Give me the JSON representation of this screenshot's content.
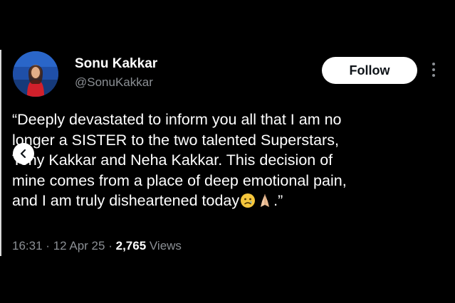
{
  "author": {
    "display_name": "Sonu Kakkar",
    "handle": "@SonuKakkar"
  },
  "follow_label": "Follow",
  "tweet": {
    "lines": [
      "“Deeply devastated to inform you all that I am no",
      "longer a SISTER to the two talented Superstars,",
      "Tony Kakkar and Neha Kakkar. This decision of",
      "mine comes from a place of deep emotional pain,",
      "and I am truly disheartened today"
    ],
    "closing": ".”",
    "emojis": [
      "sad-face-emoji",
      "folded-hands-emoji"
    ]
  },
  "meta": {
    "time": "16:31",
    "date": "12 Apr 25",
    "views_count": "2,765",
    "views_label": "Views",
    "separator": "·"
  },
  "icons": {
    "more": "vertical-dots-icon",
    "carousel": "chevron-left-icon"
  },
  "colors": {
    "background": "#000000",
    "text": "#ffffff",
    "secondary_text": "#8b8f94",
    "follow_bg": "#ffffff",
    "follow_text": "#0f1419"
  }
}
